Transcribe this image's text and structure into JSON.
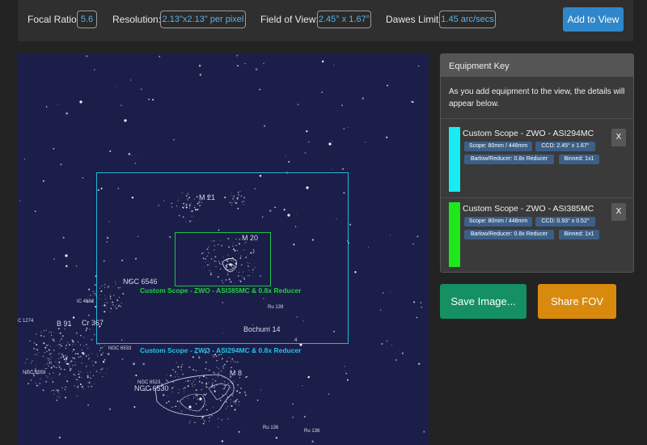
{
  "stats": {
    "focal_ratio_label": "Focal Ratio:",
    "focal_ratio_value": "5.6",
    "resolution_label": "Resolution:",
    "resolution_value": "2.13\"x2.13\" per pixel",
    "fov_label": "Field of View:",
    "fov_value": "2.45° x 1.67°",
    "dawes_label": "Dawes Limit:",
    "dawes_value": "1.45 arc/secs",
    "add_button": "Add to View"
  },
  "chart": {
    "labels": {
      "m21": "M 21",
      "m20": "M 20",
      "ngc6546": "NGC 6546",
      "ic4684": "IC 4684",
      "c1274": "C 1274",
      "b91": "B 91",
      "cr367": "Cr 367",
      "ru139": "Ru 139",
      "bochum14": "Bochum 14",
      "four": "4",
      "ngc6533": "NGC 6533",
      "ngc6559": "NGC 6559",
      "m8": "M 8",
      "ngc6523": "NGC 6523",
      "ngc6530": "NGC 6530",
      "seven": "7",
      "ru136a": "Ru 136",
      "ru136b": "Ru 136"
    },
    "fov_labels": {
      "asi385": "Custom Scope - ZWO - ASI385MC  & 0.8x Reducer",
      "asi294": "Custom Scope - ZWO - ASI294MC  & 0.8x Reducer"
    },
    "colors": {
      "background": "#1c1e4a",
      "asi294_frame": "#22b8d8",
      "asi385_frame": "#1fc24a"
    }
  },
  "equipment": {
    "title": "Equipment Key",
    "intro": "As you add equipment to the view, the details will appear below.",
    "items": [
      {
        "name": "Custom Scope - ZWO - ASI294MC",
        "color": "#18ecf2",
        "scope": "Scope: 80mm / 448mm",
        "ccd": "CCD: 2.45° x 1.67°",
        "barlow": "Barlow/Reducer: 0.8x Reducer",
        "binned": "Binned: 1x1",
        "remove": "X"
      },
      {
        "name": "Custom Scope - ZWO - ASI385MC",
        "color": "#1ce81c",
        "scope": "Scope: 80mm / 448mm",
        "ccd": "CCD: 0.93° x 0.52°",
        "barlow": "Barlow/Reducer: 0.8x Reducer",
        "binned": "Binned: 1x1",
        "remove": "X"
      }
    ]
  },
  "actions": {
    "save": "Save Image...",
    "share": "Share FOV"
  }
}
